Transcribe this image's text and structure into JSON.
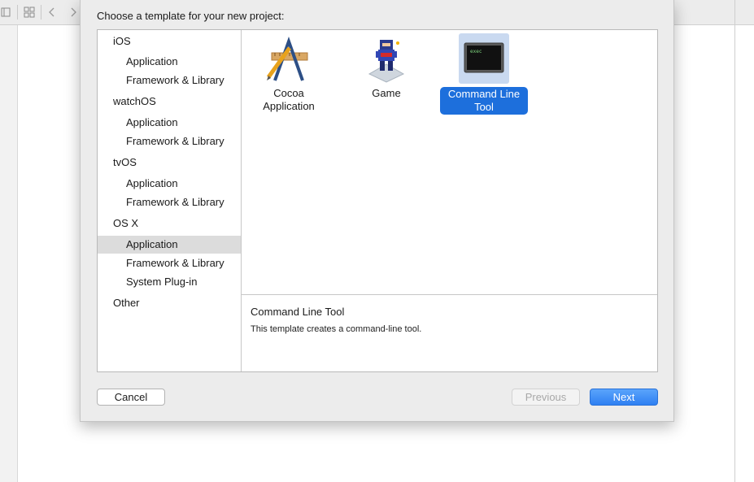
{
  "dialog": {
    "title": "Choose a template for your new project:"
  },
  "sidebar": {
    "rows": [
      {
        "label": "iOS",
        "kind": "category"
      },
      {
        "label": "Application",
        "kind": "item"
      },
      {
        "label": "Framework & Library",
        "kind": "item"
      },
      {
        "label": "watchOS",
        "kind": "category"
      },
      {
        "label": "Application",
        "kind": "item"
      },
      {
        "label": "Framework & Library",
        "kind": "item"
      },
      {
        "label": "tvOS",
        "kind": "category"
      },
      {
        "label": "Application",
        "kind": "item"
      },
      {
        "label": "Framework & Library",
        "kind": "item"
      },
      {
        "label": "OS X",
        "kind": "category"
      },
      {
        "label": "Application",
        "kind": "item",
        "selected": true
      },
      {
        "label": "Framework & Library",
        "kind": "item"
      },
      {
        "label": "System Plug-in",
        "kind": "item"
      },
      {
        "label": "Other",
        "kind": "category"
      }
    ]
  },
  "templates": [
    {
      "line1": "Cocoa",
      "line2": "Application",
      "icon": "cocoa-app-icon"
    },
    {
      "line1": "Game",
      "line2": "",
      "icon": "game-icon"
    },
    {
      "line1": "Command Line",
      "line2": "Tool",
      "icon": "terminal-icon",
      "selected": true,
      "icon_text": "exec"
    }
  ],
  "description": {
    "title": "Command Line Tool",
    "text": "This template creates a command-line tool."
  },
  "buttons": {
    "cancel": "Cancel",
    "previous": "Previous",
    "next": "Next"
  },
  "colors": {
    "accent": "#1d6fdc",
    "selection_row": "#dcdcdc"
  }
}
